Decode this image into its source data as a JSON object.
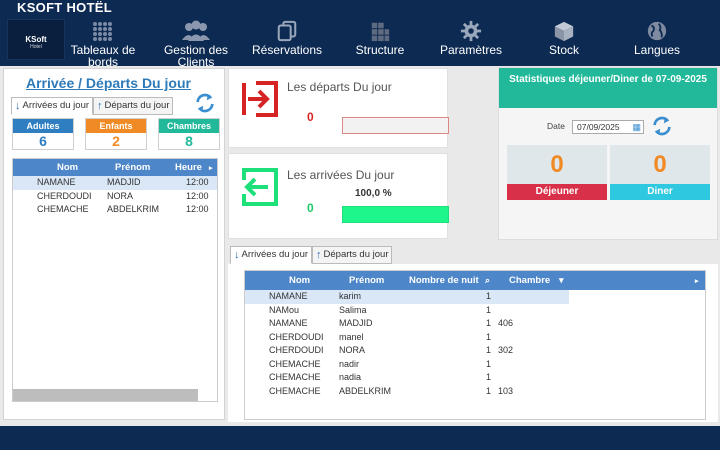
{
  "app_title": "KSOFT HOTËL",
  "logo": {
    "line1": "KSoft",
    "line2": "Hotel"
  },
  "nav": [
    {
      "label_1": "Tableaux de",
      "label_2": "bords",
      "icon": "grid-dots-icon"
    },
    {
      "label_1": "Gestion des",
      "label_2": "Clients",
      "icon": "users-icon"
    },
    {
      "label_1": "Réservations",
      "label_2": "",
      "icon": "copy-icon"
    },
    {
      "label_1": "Structure",
      "label_2": "",
      "icon": "building-icon"
    },
    {
      "label_1": "Paramètres",
      "label_2": "",
      "icon": "gear-icon"
    },
    {
      "label_1": "Stock",
      "label_2": "",
      "icon": "box-icon"
    },
    {
      "label_1": "Langues",
      "label_2": "",
      "icon": "globe-icon"
    }
  ],
  "left": {
    "title": "Arrivée / Départs  Du jour",
    "tab_arrivals": "Arrivées du jour",
    "tab_departures": "Départs du jour",
    "stats": [
      {
        "label": "Adultes",
        "value": "6",
        "color": "#2f7ec2"
      },
      {
        "label": "Enfants",
        "value": "2",
        "color": "#f08a24"
      },
      {
        "label": "Chambres",
        "value": "8",
        "color": "#21b99a"
      }
    ],
    "columns": [
      "Nom",
      "Prénom",
      "Heure"
    ],
    "rows": [
      {
        "nom": "NAMANE",
        "prenom": "MADJID",
        "heure": "12:00"
      },
      {
        "nom": "CHERDOUDI",
        "prenom": "NORA",
        "heure": "12:00"
      },
      {
        "nom": "CHEMACHE",
        "prenom": "ABDELKRIM",
        "heure": "12:00"
      }
    ]
  },
  "departures_card": {
    "title": "Les départs  Du jour",
    "count": "0",
    "progress": 0
  },
  "arrivals_card": {
    "title": "Les arrivées Du jour",
    "count": "0",
    "percent_label": "100,0 %",
    "progress": 1.0
  },
  "meals": {
    "title": "Statistiques déjeuner/Diner de 07-09-2025",
    "date_label": "Date",
    "date_value": "07/09/2025",
    "dejeuner_value": "0",
    "dejeuner_label": "Déjeuner",
    "diner_value": "0",
    "diner_label": "Diner"
  },
  "bottom": {
    "tab_arrivals": "Arrivées du jour",
    "tab_departures": "Départs du jour",
    "columns": [
      "Nom",
      "Prénom",
      "Nombre de nuit",
      "Chambre"
    ],
    "rows": [
      {
        "nom": "NAMANE",
        "prenom": "karim",
        "nuits": "1",
        "chambre": ""
      },
      {
        "nom": "NAMou",
        "prenom": "Salima",
        "nuits": "1",
        "chambre": ""
      },
      {
        "nom": "NAMANE",
        "prenom": "MADJID",
        "nuits": "1",
        "chambre": "406"
      },
      {
        "nom": "CHERDOUDI",
        "prenom": "manel",
        "nuits": "1",
        "chambre": ""
      },
      {
        "nom": "CHERDOUDI",
        "prenom": "NORA",
        "nuits": "1",
        "chambre": "302"
      },
      {
        "nom": "CHEMACHE",
        "prenom": "nadir",
        "nuits": "1",
        "chambre": ""
      },
      {
        "nom": "CHEMACHE",
        "prenom": "nadia",
        "nuits": "1",
        "chambre": ""
      },
      {
        "nom": "CHEMACHE",
        "prenom": "ABDELKRIM",
        "nuits": "1",
        "chambre": "103"
      }
    ]
  },
  "colors": {
    "navy": "#0d2a52",
    "teal": "#21b99a",
    "blue_header": "#4d86c9",
    "red": "#d9304a",
    "cyan": "#2ec8e0",
    "green": "#1ee07a",
    "orange": "#f08a24"
  }
}
